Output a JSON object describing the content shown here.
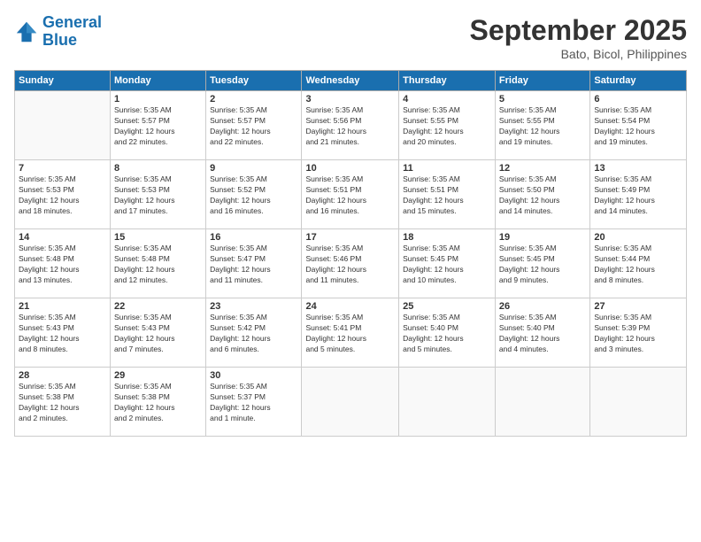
{
  "header": {
    "logo_general": "General",
    "logo_blue": "Blue",
    "month": "September 2025",
    "location": "Bato, Bicol, Philippines"
  },
  "days_of_week": [
    "Sunday",
    "Monday",
    "Tuesday",
    "Wednesday",
    "Thursday",
    "Friday",
    "Saturday"
  ],
  "weeks": [
    [
      {
        "day": "",
        "info": ""
      },
      {
        "day": "1",
        "info": "Sunrise: 5:35 AM\nSunset: 5:57 PM\nDaylight: 12 hours\nand 22 minutes."
      },
      {
        "day": "2",
        "info": "Sunrise: 5:35 AM\nSunset: 5:57 PM\nDaylight: 12 hours\nand 22 minutes."
      },
      {
        "day": "3",
        "info": "Sunrise: 5:35 AM\nSunset: 5:56 PM\nDaylight: 12 hours\nand 21 minutes."
      },
      {
        "day": "4",
        "info": "Sunrise: 5:35 AM\nSunset: 5:55 PM\nDaylight: 12 hours\nand 20 minutes."
      },
      {
        "day": "5",
        "info": "Sunrise: 5:35 AM\nSunset: 5:55 PM\nDaylight: 12 hours\nand 19 minutes."
      },
      {
        "day": "6",
        "info": "Sunrise: 5:35 AM\nSunset: 5:54 PM\nDaylight: 12 hours\nand 19 minutes."
      }
    ],
    [
      {
        "day": "7",
        "info": "Sunrise: 5:35 AM\nSunset: 5:53 PM\nDaylight: 12 hours\nand 18 minutes."
      },
      {
        "day": "8",
        "info": "Sunrise: 5:35 AM\nSunset: 5:53 PM\nDaylight: 12 hours\nand 17 minutes."
      },
      {
        "day": "9",
        "info": "Sunrise: 5:35 AM\nSunset: 5:52 PM\nDaylight: 12 hours\nand 16 minutes."
      },
      {
        "day": "10",
        "info": "Sunrise: 5:35 AM\nSunset: 5:51 PM\nDaylight: 12 hours\nand 16 minutes."
      },
      {
        "day": "11",
        "info": "Sunrise: 5:35 AM\nSunset: 5:51 PM\nDaylight: 12 hours\nand 15 minutes."
      },
      {
        "day": "12",
        "info": "Sunrise: 5:35 AM\nSunset: 5:50 PM\nDaylight: 12 hours\nand 14 minutes."
      },
      {
        "day": "13",
        "info": "Sunrise: 5:35 AM\nSunset: 5:49 PM\nDaylight: 12 hours\nand 14 minutes."
      }
    ],
    [
      {
        "day": "14",
        "info": "Sunrise: 5:35 AM\nSunset: 5:48 PM\nDaylight: 12 hours\nand 13 minutes."
      },
      {
        "day": "15",
        "info": "Sunrise: 5:35 AM\nSunset: 5:48 PM\nDaylight: 12 hours\nand 12 minutes."
      },
      {
        "day": "16",
        "info": "Sunrise: 5:35 AM\nSunset: 5:47 PM\nDaylight: 12 hours\nand 11 minutes."
      },
      {
        "day": "17",
        "info": "Sunrise: 5:35 AM\nSunset: 5:46 PM\nDaylight: 12 hours\nand 11 minutes."
      },
      {
        "day": "18",
        "info": "Sunrise: 5:35 AM\nSunset: 5:45 PM\nDaylight: 12 hours\nand 10 minutes."
      },
      {
        "day": "19",
        "info": "Sunrise: 5:35 AM\nSunset: 5:45 PM\nDaylight: 12 hours\nand 9 minutes."
      },
      {
        "day": "20",
        "info": "Sunrise: 5:35 AM\nSunset: 5:44 PM\nDaylight: 12 hours\nand 8 minutes."
      }
    ],
    [
      {
        "day": "21",
        "info": "Sunrise: 5:35 AM\nSunset: 5:43 PM\nDaylight: 12 hours\nand 8 minutes."
      },
      {
        "day": "22",
        "info": "Sunrise: 5:35 AM\nSunset: 5:43 PM\nDaylight: 12 hours\nand 7 minutes."
      },
      {
        "day": "23",
        "info": "Sunrise: 5:35 AM\nSunset: 5:42 PM\nDaylight: 12 hours\nand 6 minutes."
      },
      {
        "day": "24",
        "info": "Sunrise: 5:35 AM\nSunset: 5:41 PM\nDaylight: 12 hours\nand 5 minutes."
      },
      {
        "day": "25",
        "info": "Sunrise: 5:35 AM\nSunset: 5:40 PM\nDaylight: 12 hours\nand 5 minutes."
      },
      {
        "day": "26",
        "info": "Sunrise: 5:35 AM\nSunset: 5:40 PM\nDaylight: 12 hours\nand 4 minutes."
      },
      {
        "day": "27",
        "info": "Sunrise: 5:35 AM\nSunset: 5:39 PM\nDaylight: 12 hours\nand 3 minutes."
      }
    ],
    [
      {
        "day": "28",
        "info": "Sunrise: 5:35 AM\nSunset: 5:38 PM\nDaylight: 12 hours\nand 2 minutes."
      },
      {
        "day": "29",
        "info": "Sunrise: 5:35 AM\nSunset: 5:38 PM\nDaylight: 12 hours\nand 2 minutes."
      },
      {
        "day": "30",
        "info": "Sunrise: 5:35 AM\nSunset: 5:37 PM\nDaylight: 12 hours\nand 1 minute."
      },
      {
        "day": "",
        "info": ""
      },
      {
        "day": "",
        "info": ""
      },
      {
        "day": "",
        "info": ""
      },
      {
        "day": "",
        "info": ""
      }
    ]
  ]
}
